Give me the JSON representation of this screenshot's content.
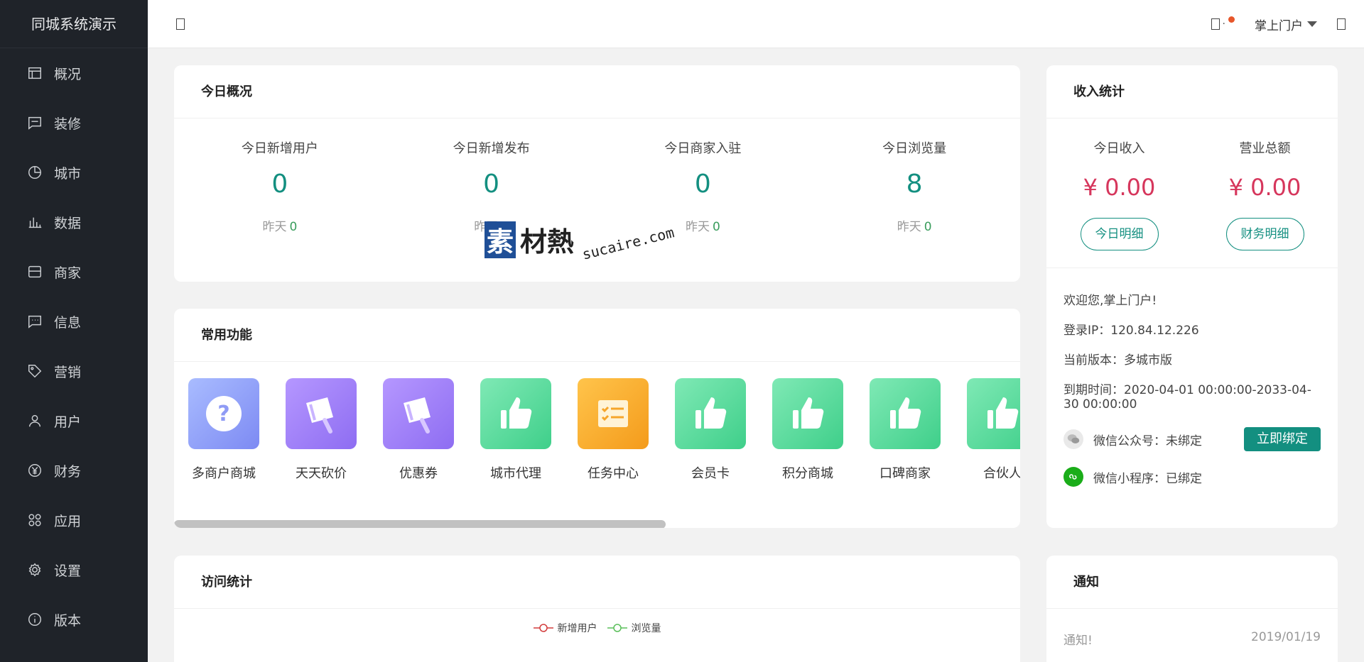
{
  "brand": "同城系统演示",
  "sidebar": {
    "items": [
      {
        "label": "概况"
      },
      {
        "label": "装修"
      },
      {
        "label": "城市"
      },
      {
        "label": "数据"
      },
      {
        "label": "商家"
      },
      {
        "label": "信息"
      },
      {
        "label": "营销"
      },
      {
        "label": "用户"
      },
      {
        "label": "财务"
      },
      {
        "label": "应用"
      },
      {
        "label": "设置"
      },
      {
        "label": "版本"
      }
    ]
  },
  "topbar": {
    "user": "掌上门户",
    "badge_color": "#e7562a"
  },
  "today": {
    "title": "今日概况",
    "yesterday_label": "昨天",
    "stats": [
      {
        "label": "今日新增用户",
        "value": "0",
        "yesterday": "0"
      },
      {
        "label": "今日新增发布",
        "value": "0",
        "yesterday": "0"
      },
      {
        "label": "今日商家入驻",
        "value": "0",
        "yesterday": "0"
      },
      {
        "label": "今日浏览量",
        "value": "8",
        "yesterday": "0"
      }
    ]
  },
  "income": {
    "title": "收入统计",
    "items": [
      {
        "label": "今日收入",
        "value": "¥ 0.00",
        "button": "今日明细"
      },
      {
        "label": "营业总额",
        "value": "¥ 0.00",
        "button": "财务明细"
      }
    ]
  },
  "account": {
    "welcome": "欢迎您,掌上门户!",
    "login_ip": "登录IP：120.84.12.226",
    "version": "当前版本：多城市版",
    "expire": "到期时间：2020-04-01 00:00:00-2033-04-30 00:00:00",
    "wechat_mp": "微信公众号：未绑定",
    "bind_button": "立即绑定",
    "wechat_mini": "微信小程序：已绑定"
  },
  "functions": {
    "title": "常用功能",
    "items": [
      {
        "label": "多商户商城",
        "icon": "question-icon"
      },
      {
        "label": "天天砍价",
        "icon": "megaphone-icon"
      },
      {
        "label": "优惠券",
        "icon": "megaphone-icon"
      },
      {
        "label": "城市代理",
        "icon": "thumbs-up-icon"
      },
      {
        "label": "任务中心",
        "icon": "checklist-icon"
      },
      {
        "label": "会员卡",
        "icon": "thumbs-up-icon"
      },
      {
        "label": "积分商城",
        "icon": "thumbs-up-icon"
      },
      {
        "label": "口碑商家",
        "icon": "thumbs-up-icon"
      },
      {
        "label": "合伙人",
        "icon": "thumbs-up-icon"
      }
    ]
  },
  "visits": {
    "title": "访问统计",
    "legend": [
      {
        "name": "新增用户",
        "color": "#d23b3b"
      },
      {
        "name": "浏览量",
        "color": "#5bbf5b"
      }
    ]
  },
  "notice": {
    "title": "通知",
    "items": [
      {
        "text": "通知!",
        "date": "2019/01/19"
      }
    ]
  },
  "watermark": {
    "mark": "素",
    "text": "材熱",
    "url": "sucaire.com"
  }
}
